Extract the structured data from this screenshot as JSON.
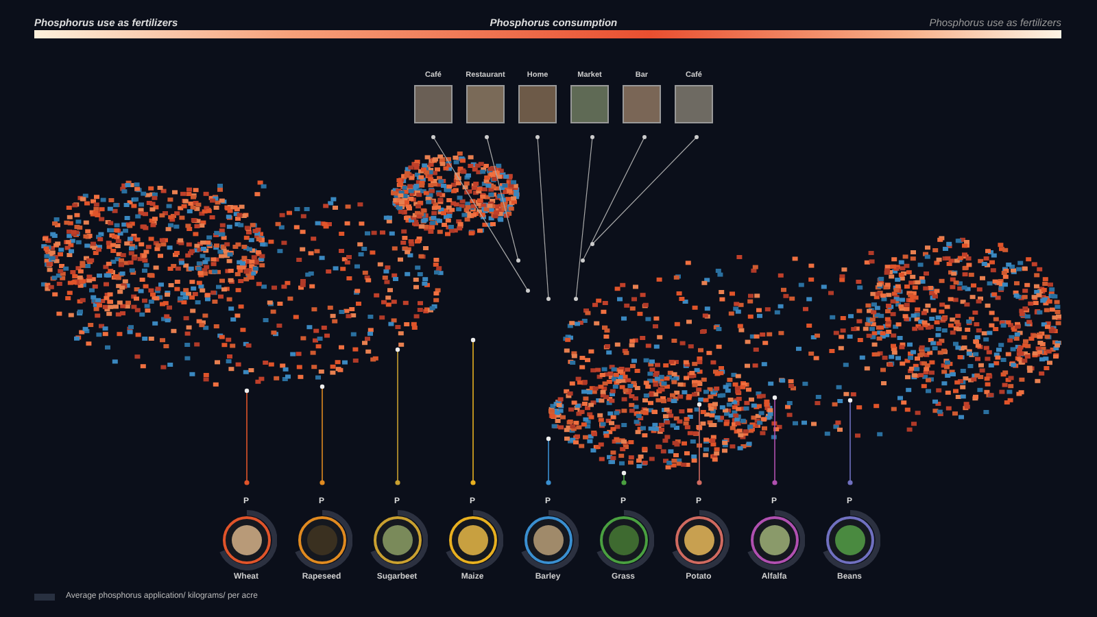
{
  "scale_bar": {
    "left_label": "Phosphorus use as fertilizers",
    "center_label": "Phosphorus consumption",
    "right_label": "Phosphorus use as fertilizers"
  },
  "venues": [
    {
      "label": "Café"
    },
    {
      "label": "Restaurant"
    },
    {
      "label": "Home"
    },
    {
      "label": "Market"
    },
    {
      "label": "Bar"
    },
    {
      "label": "Café"
    }
  ],
  "crops": [
    {
      "symbol": "P",
      "name": "Wheat",
      "color": "#e0542a"
    },
    {
      "symbol": "P",
      "name": "Rapeseed",
      "color": "#e08a20"
    },
    {
      "symbol": "P",
      "name": "Sugarbeet",
      "color": "#c9a030"
    },
    {
      "symbol": "P",
      "name": "Maize",
      "color": "#e8b020"
    },
    {
      "symbol": "P",
      "name": "Barley",
      "color": "#3a8fd0"
    },
    {
      "symbol": "P",
      "name": "Grass",
      "color": "#4aa040"
    },
    {
      "symbol": "P",
      "name": "Potato",
      "color": "#d06a60"
    },
    {
      "symbol": "P",
      "name": "Alfalfa",
      "color": "#b050b0"
    },
    {
      "symbol": "P",
      "name": "Beans",
      "color": "#7070c0"
    }
  ],
  "legend": {
    "label": "Average phosphorus application/ kilograms/ per acre"
  }
}
